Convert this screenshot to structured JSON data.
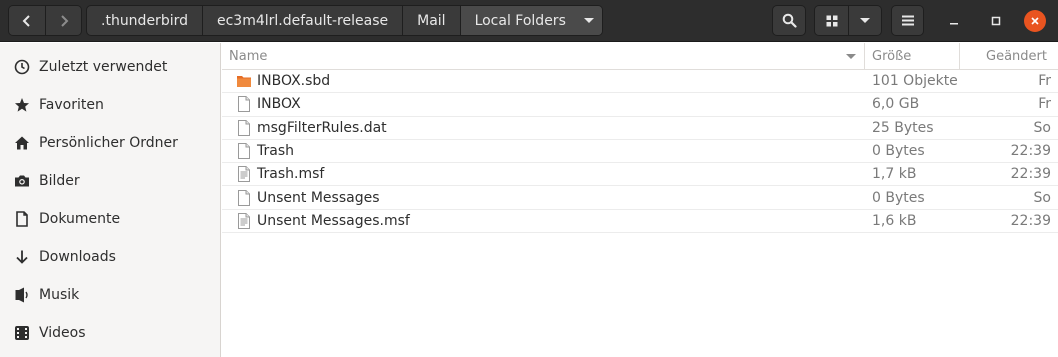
{
  "breadcrumb": {
    "items": [
      ".thunderbird",
      "ec3m4lrl.default-release",
      "Mail",
      "Local Folders"
    ]
  },
  "sidebar": {
    "items": [
      {
        "label": "Zuletzt verwendet",
        "icon": "clock-icon"
      },
      {
        "label": "Favoriten",
        "icon": "star-icon"
      },
      {
        "label": "Persönlicher Ordner",
        "icon": "home-icon"
      },
      {
        "label": "Bilder",
        "icon": "camera-icon"
      },
      {
        "label": "Dokumente",
        "icon": "document-icon"
      },
      {
        "label": "Downloads",
        "icon": "download-arrow-icon"
      },
      {
        "label": "Musik",
        "icon": "music-icon"
      },
      {
        "label": "Videos",
        "icon": "video-icon"
      }
    ]
  },
  "columns": {
    "name": "Name",
    "size": "Größe",
    "modified": "Geändert"
  },
  "files": [
    {
      "name": "INBOX.sbd",
      "size": "101 Objekte",
      "modified": "Fr",
      "icon": "folder-icon"
    },
    {
      "name": "INBOX",
      "size": "6,0 GB",
      "modified": "Fr",
      "icon": "file-icon"
    },
    {
      "name": "msgFilterRules.dat",
      "size": "25 Bytes",
      "modified": "So",
      "icon": "file-icon"
    },
    {
      "name": "Trash",
      "size": "0 Bytes",
      "modified": "22:39",
      "icon": "file-icon"
    },
    {
      "name": "Trash.msf",
      "size": "1,7 kB",
      "modified": "22:39",
      "icon": "text-file-icon"
    },
    {
      "name": "Unsent Messages",
      "size": "0 Bytes",
      "modified": "So",
      "icon": "file-icon"
    },
    {
      "name": "Unsent Messages.msf",
      "size": "1,6 kB",
      "modified": "22:39",
      "icon": "text-file-icon"
    }
  ],
  "colors": {
    "accent": "#e95420",
    "header": "#2d2d2d",
    "folder": "#e66d25"
  }
}
